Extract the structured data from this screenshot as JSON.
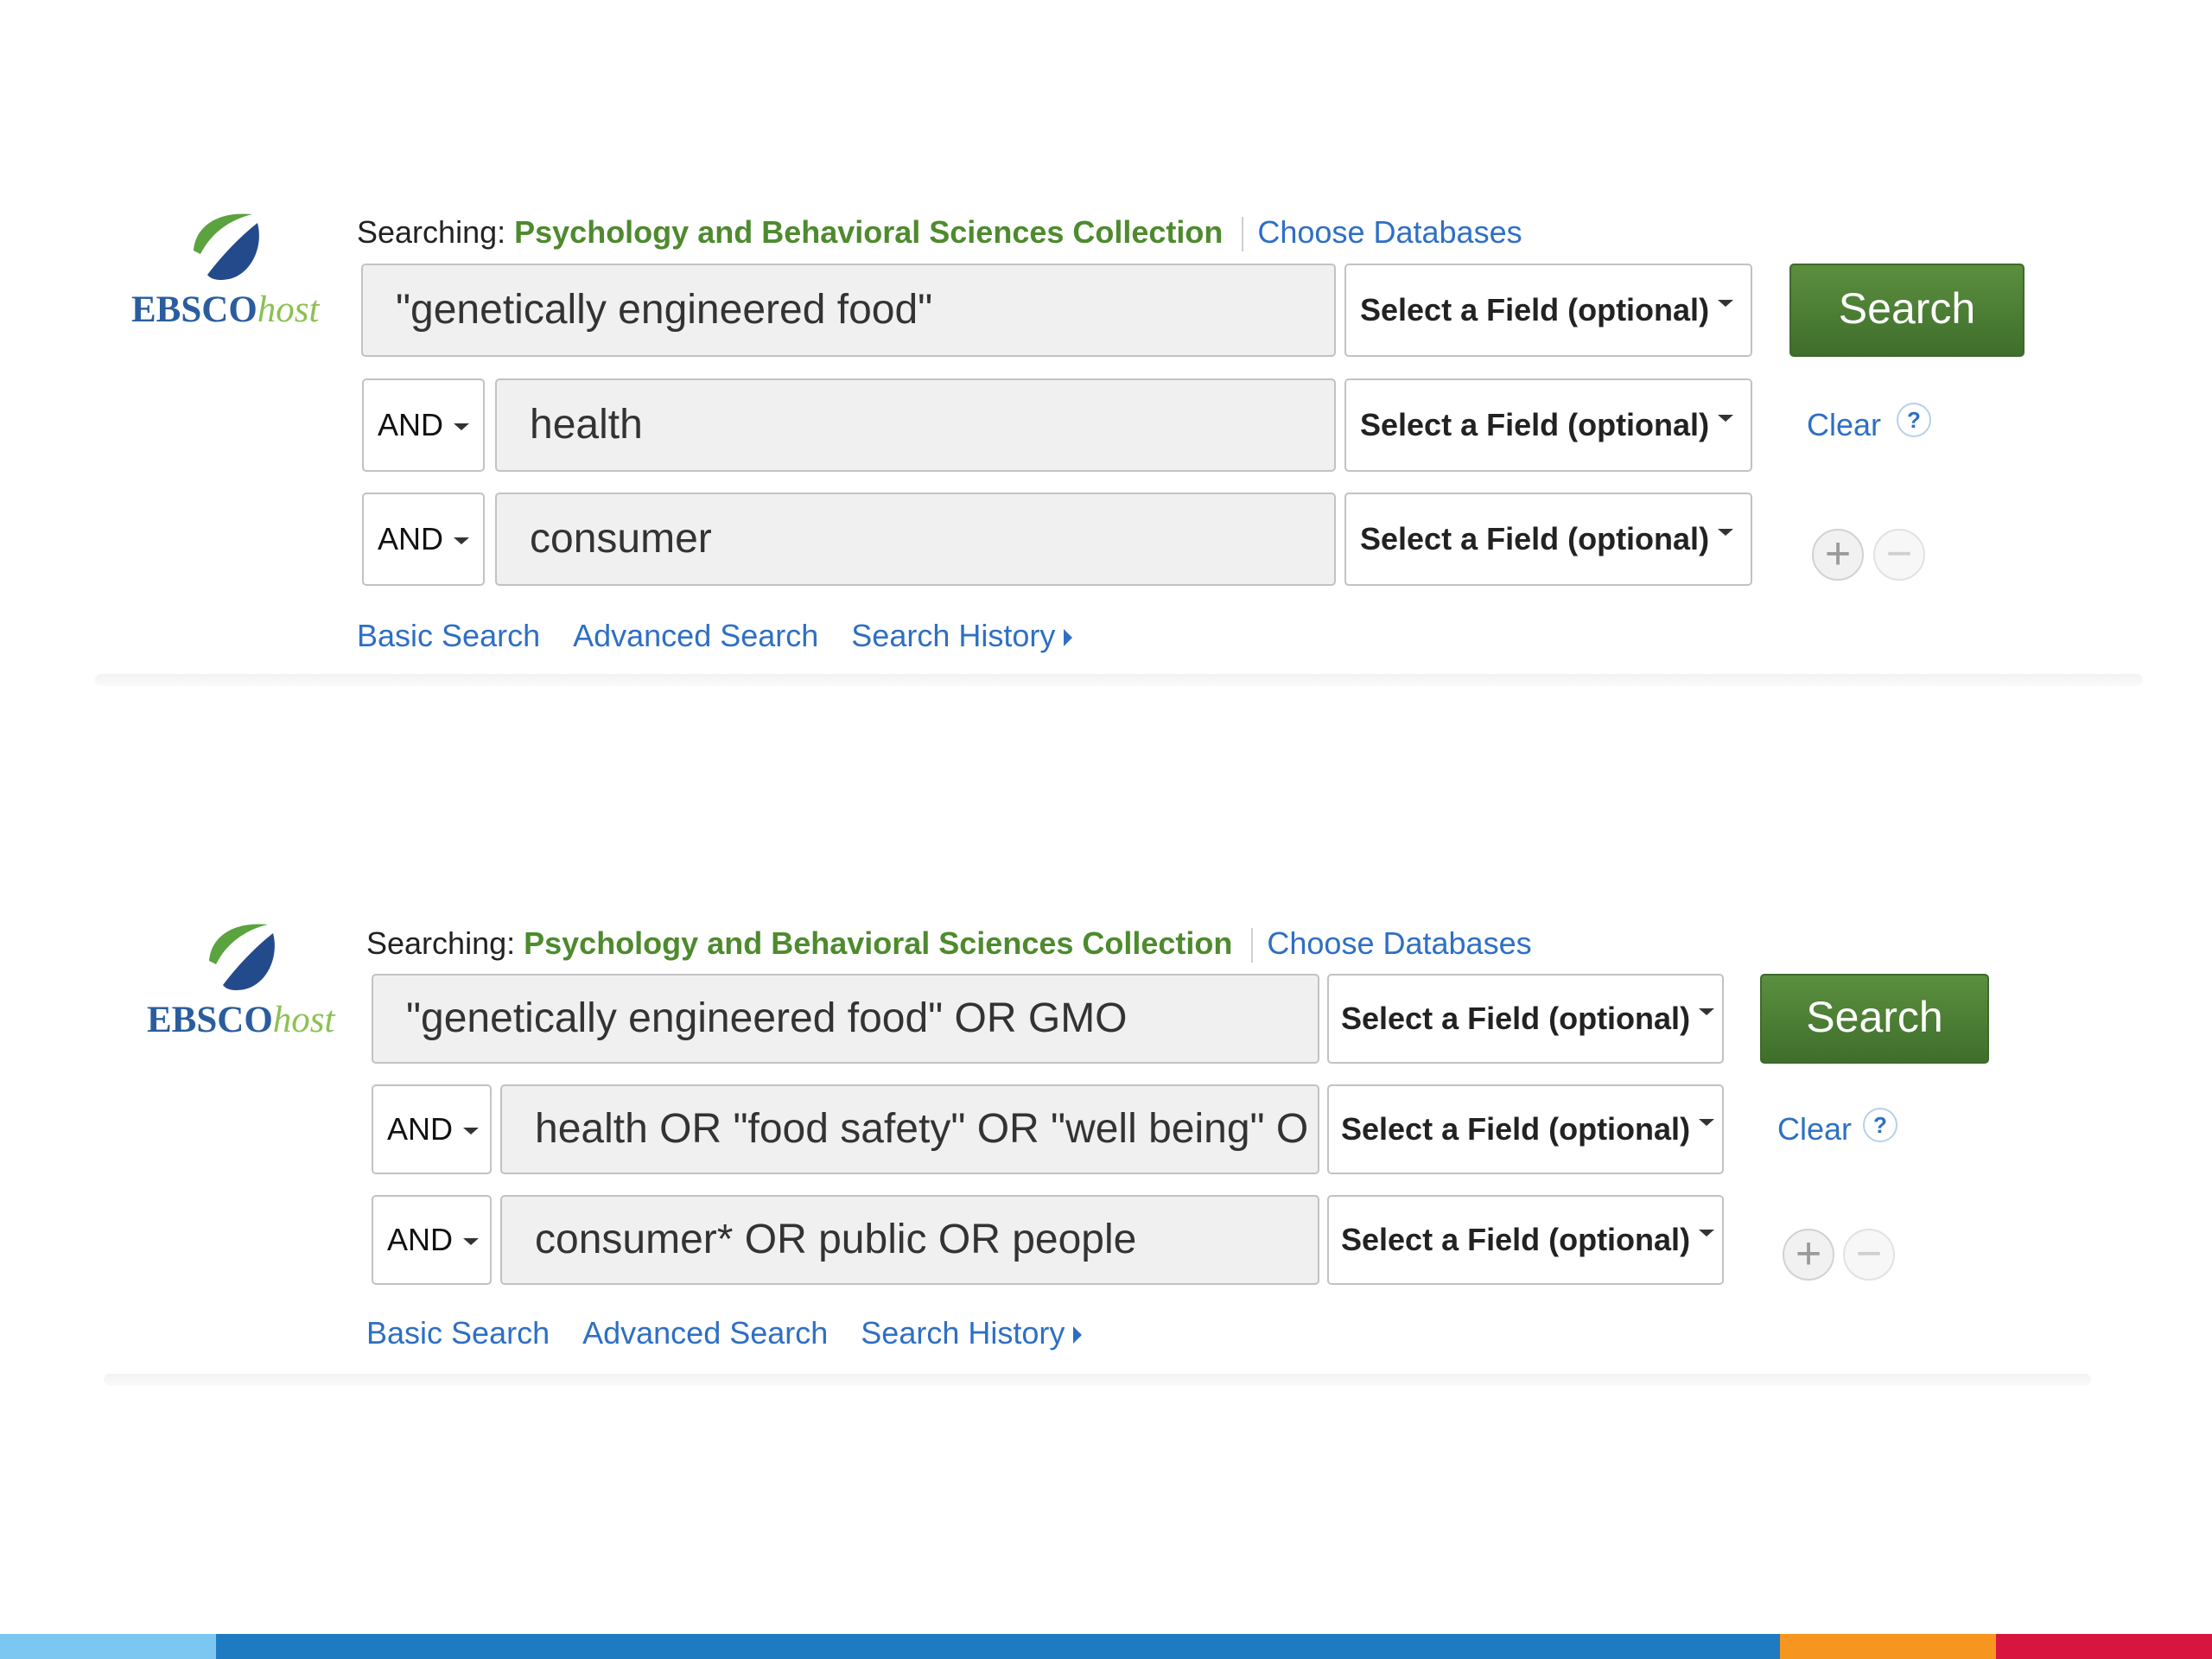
{
  "panels": [
    {
      "brand": {
        "ebsco": "EBSCO",
        "host": "host"
      },
      "searching_label": "Searching:",
      "collection": "Psychology and Behavioral Sciences Collection",
      "choose_databases": "Choose Databases",
      "rows": [
        {
          "query": "\"genetically engineered food\"",
          "field": "Select a Field (optional)"
        },
        {
          "operator": "AND",
          "query": "health",
          "field": "Select a Field (optional)"
        },
        {
          "operator": "AND",
          "query": "consumer",
          "field": "Select a Field (optional)"
        }
      ],
      "search_button": "Search",
      "clear_link": "Clear",
      "help_icon": "?",
      "add_row_icon": "+",
      "remove_row_icon": "−",
      "links": {
        "basic": "Basic Search",
        "advanced": "Advanced Search",
        "history": "Search History"
      }
    },
    {
      "brand": {
        "ebsco": "EBSCO",
        "host": "host"
      },
      "searching_label": "Searching:",
      "collection": "Psychology and Behavioral Sciences Collection",
      "choose_databases": "Choose Databases",
      "rows": [
        {
          "query": "\"genetically engineered food\" OR GMO",
          "field": "Select a Field (optional)"
        },
        {
          "operator": "AND",
          "query": "health OR \"food safety\" OR \"well being\" O",
          "field": "Select a Field (optional)"
        },
        {
          "operator": "AND",
          "query": "consumer* OR public OR people",
          "field": "Select a Field (optional)"
        }
      ],
      "search_button": "Search",
      "clear_link": "Clear",
      "help_icon": "?",
      "add_row_icon": "+",
      "remove_row_icon": "−",
      "links": {
        "basic": "Basic Search",
        "advanced": "Advanced Search",
        "history": "Search History"
      }
    }
  ],
  "colors": {
    "link": "#2e6fc4",
    "collection": "#4e8a2e",
    "search_button": "#4a7d33",
    "logo_green": "#5aa33f",
    "logo_blue": "#234b8c",
    "bottom_bar": [
      "#7cc7f2",
      "#1f7bc1",
      "#f6951f",
      "#d8153e"
    ]
  }
}
